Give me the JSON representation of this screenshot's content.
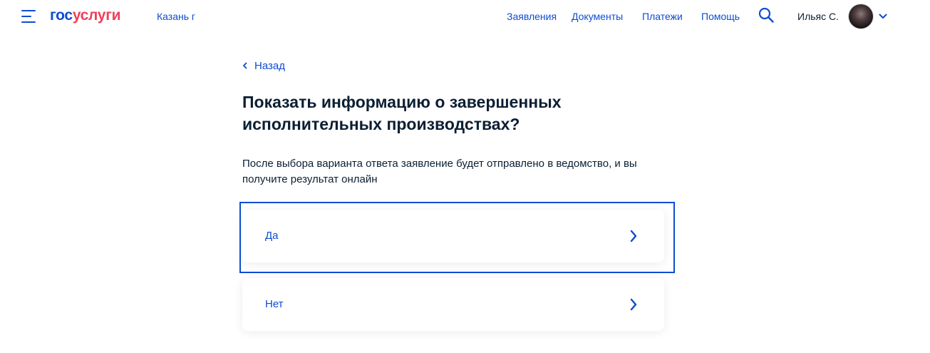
{
  "header": {
    "logo_part1": "гос",
    "logo_part2": "услуги",
    "city": "Казань г",
    "nav": [
      "Заявления",
      "Документы",
      "Платежи",
      "Помощь"
    ],
    "user_name": "Ильяс С.",
    "icons": {
      "menu": "menu-icon",
      "search": "search-icon",
      "avatar": "avatar",
      "dropdown": "chevron-down-icon"
    }
  },
  "main": {
    "back_label": "Назад",
    "title": "Показать информацию о завершенных исполнительных производствах?",
    "description": "После выбора варианта ответа заявление будет отправлено в ведомство, и вы получите результат онлайн",
    "options": [
      {
        "label": "Да",
        "focused": true
      },
      {
        "label": "Нет",
        "focused": false
      }
    ]
  },
  "colors": {
    "accent": "#0d4cd3",
    "brand_red": "#ee3f58",
    "text": "#0b1f33"
  }
}
